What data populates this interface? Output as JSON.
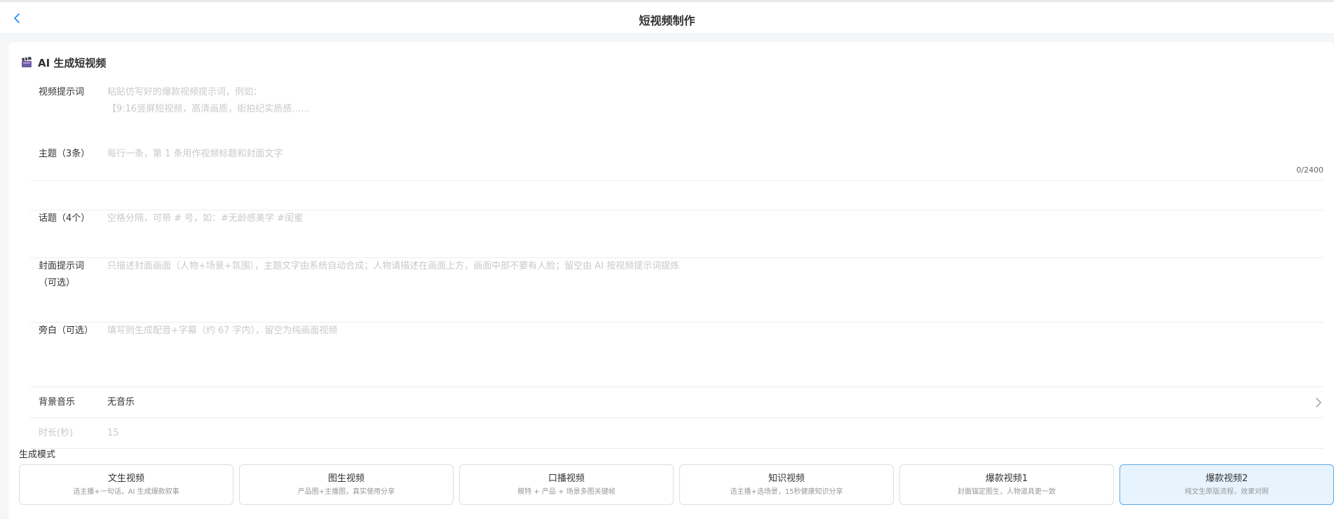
{
  "header": {
    "title": "短视频制作"
  },
  "card": {
    "title": "AI 生成短视频"
  },
  "fields": {
    "prompt": {
      "label": "视频提示词",
      "placeholder": "粘贴仿写好的爆款视频提示词，例如：\n【9:16竖屏短视频，高清画质，街拍纪实质感……",
      "count": "0/2400"
    },
    "topic": {
      "label": "主题（3条）",
      "placeholder": "每行一条，第 1 条用作视频标题和封面文字"
    },
    "hashtags": {
      "label": "话题（4个）",
      "placeholder": "空格分隔，可带 # 号，如：#无龄感美学 #闺蜜"
    },
    "cover": {
      "label": "封面提示词\n（可选）",
      "placeholder": "只描述封面画面（人物+场景+氛围），主题文字由系统自动合成；人物请描述在画面上方，画面中部不要有人脸；留空由 AI 按视频提示词提炼"
    },
    "narration": {
      "label": "旁白（可选）",
      "placeholder": "填写则生成配音+字幕（约 67 字内），留空为纯画面视频"
    },
    "music": {
      "label": "背景音乐",
      "value": "无音乐"
    },
    "duration": {
      "label": "时长(秒)",
      "value": "15"
    }
  },
  "modes": {
    "label": "生成模式",
    "items": [
      {
        "title": "文生视频",
        "desc": "选主播+一句话，AI 生成爆款叙事"
      },
      {
        "title": "图生视频",
        "desc": "产品图+主播图，真实使用分享"
      },
      {
        "title": "口播视频",
        "desc": "模特 + 产品 + 场景多图关键帧"
      },
      {
        "title": "知识视频",
        "desc": "选主播+选场景，15秒健康知识分享"
      },
      {
        "title": "爆款视频1",
        "desc": "封面锚定图生，人物道具更一致"
      },
      {
        "title": "爆款视频2",
        "desc": "纯文生原版流程，效果对照"
      }
    ],
    "selected": "爆款视频2"
  },
  "colors": {
    "accent": "#1989fa",
    "selected_bg": "#e8f4fd",
    "selected_border": "#5ea9e8"
  }
}
